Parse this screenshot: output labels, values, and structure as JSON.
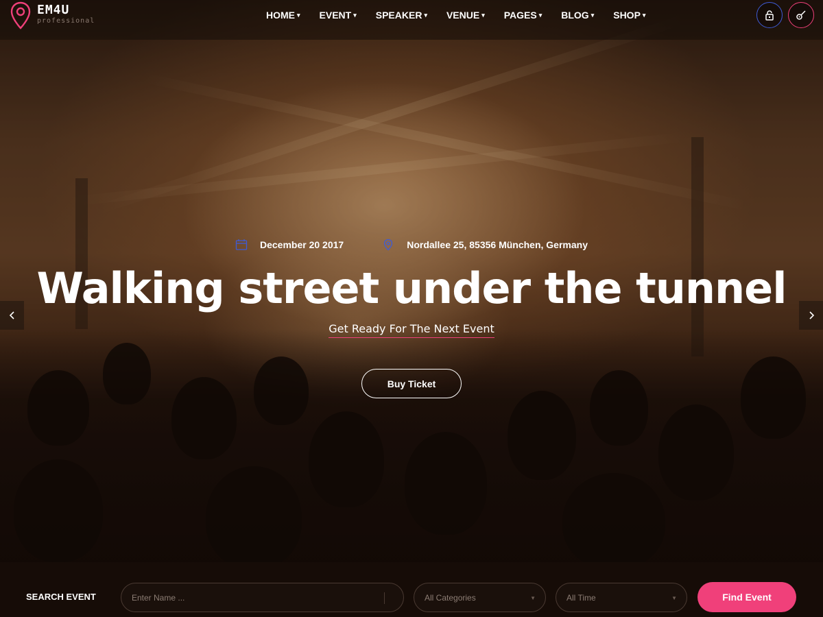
{
  "brand": {
    "name": "EM4U",
    "tagline": "professional",
    "pin_color": "#f0407a"
  },
  "nav": {
    "items": [
      {
        "label": "HOME",
        "has_dropdown": true
      },
      {
        "label": "EVENT",
        "has_dropdown": true
      },
      {
        "label": "SPEAKER",
        "has_dropdown": true
      },
      {
        "label": "VENUE",
        "has_dropdown": true
      },
      {
        "label": "PAGES",
        "has_dropdown": true
      },
      {
        "label": "BLOG",
        "has_dropdown": true
      },
      {
        "label": "SHOP",
        "has_dropdown": true
      }
    ],
    "caret": "▾"
  },
  "header_icons": {
    "login": {
      "icon": "lock-icon",
      "color": "#3f5bd6"
    },
    "register": {
      "icon": "guitar-icon",
      "color": "#f0407a"
    }
  },
  "hero": {
    "date": "December 20 2017",
    "date_icon": "calendar-icon",
    "location": "Nordallee 25, 85356 München, Germany",
    "location_icon": "location-pin-icon",
    "title": "Walking street under the tunnel",
    "subtitle": "Get Ready For The Next Event",
    "button_label": "Buy Ticket",
    "prev_arrow": "‹",
    "next_arrow": "›",
    "accent_color": "#f0407a",
    "icon_color": "#3f5bd6"
  },
  "search": {
    "label": "SEARCH EVENT",
    "name_placeholder": "Enter Name ...",
    "category_value": "All Categories",
    "time_value": "All Time",
    "button_label": "Find Event",
    "button_color": "#f0407a"
  }
}
